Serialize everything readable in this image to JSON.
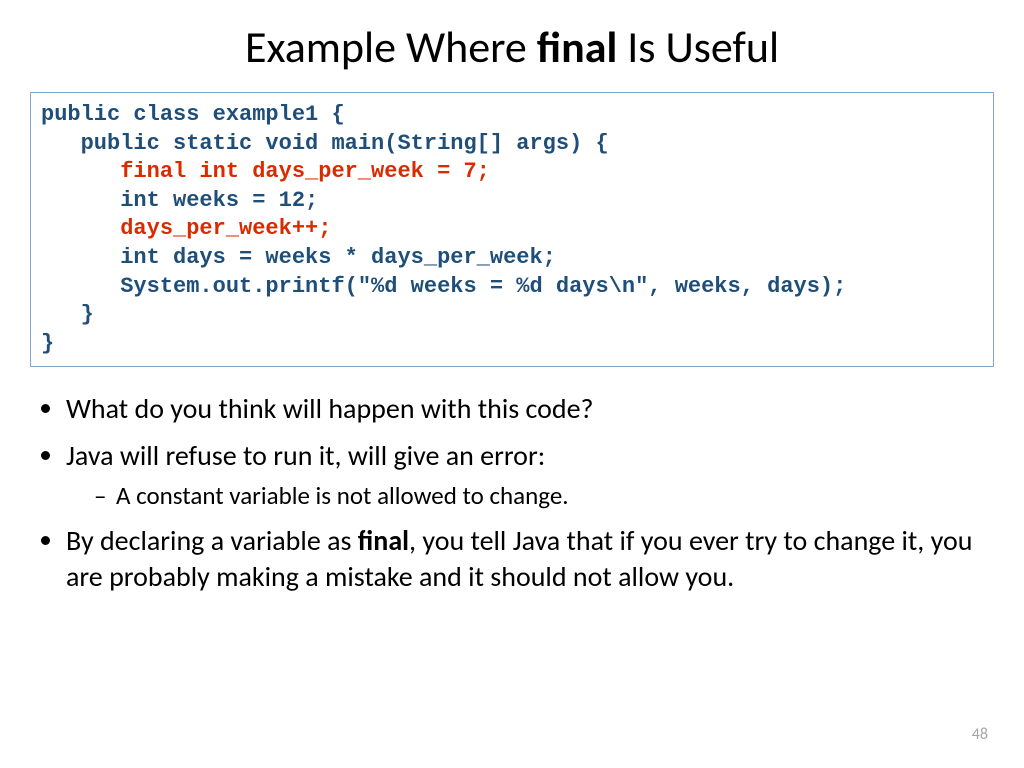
{
  "title_pre": "Example Where ",
  "title_bold": "final",
  "title_post": " Is Useful",
  "code": {
    "l1": "public class example1 {",
    "l2": "   public static void main(String[] args) {",
    "l3": "      final int days_per_week = 7;",
    "l4": "      int weeks = 12;",
    "l5": "      days_per_week++;",
    "l6": "      int days = weeks * days_per_week;",
    "l7": "      System.out.printf(\"%d weeks = %d days\\n\", weeks, days);",
    "l8": "   }",
    "l9": "}"
  },
  "bullets": {
    "b1": "What do you think will happen with this code?",
    "b2": "Java will refuse to run it, will give an error:",
    "b2sub": "A constant variable is not allowed to change.",
    "b3_pre": "By declaring a variable as ",
    "b3_bold": "final",
    "b3_post": ", you tell Java that if you ever try to change it, you are probably making a mistake and it should not allow you."
  },
  "page_number": "48"
}
